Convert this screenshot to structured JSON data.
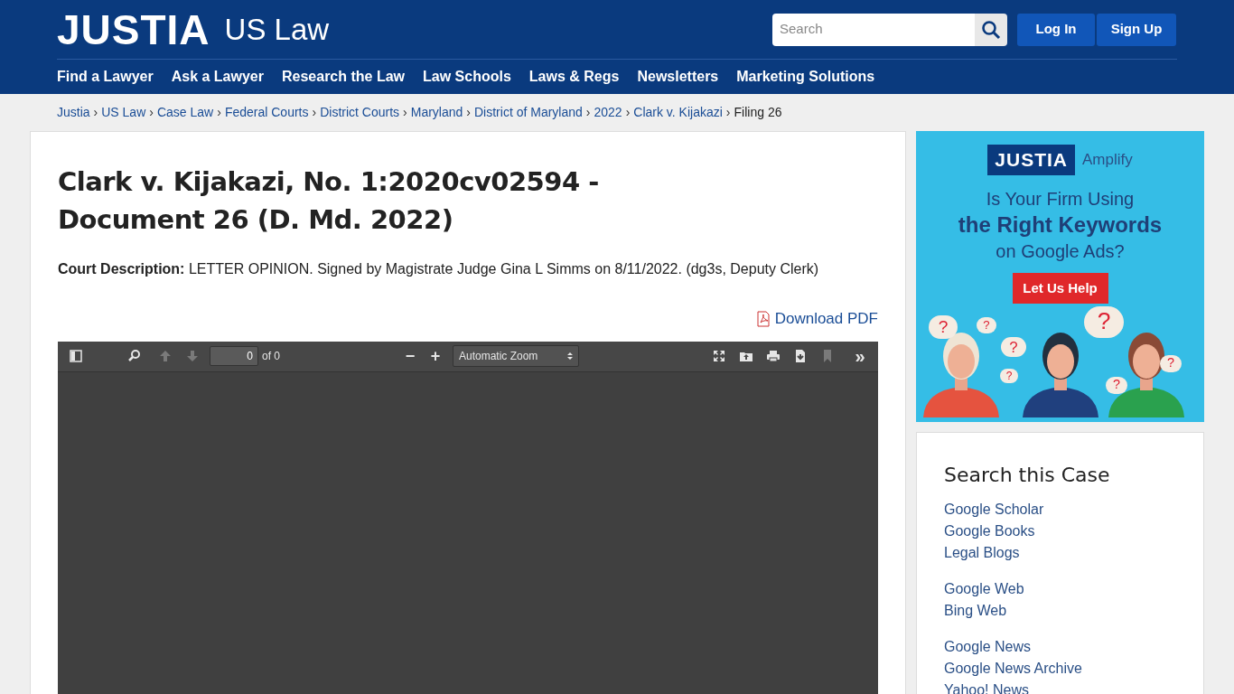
{
  "header": {
    "logo": "JUSTIA",
    "section": "US Law",
    "search": {
      "placeholder": "Search"
    },
    "buttons": [
      "Log In",
      "Sign Up"
    ],
    "nav": [
      "Find a Lawyer",
      "Ask a Lawyer",
      "Research the Law",
      "Law Schools",
      "Laws & Regs",
      "Newsletters",
      "Marketing Solutions"
    ]
  },
  "breadcrumbs": [
    {
      "label": "Justia",
      "link": true
    },
    {
      "label": "US Law",
      "link": true
    },
    {
      "label": "Case Law",
      "link": true
    },
    {
      "label": "Federal Courts",
      "link": true
    },
    {
      "label": "District Courts",
      "link": true
    },
    {
      "label": "Maryland",
      "link": true
    },
    {
      "label": "District of Maryland",
      "link": true
    },
    {
      "label": "2022",
      "link": true
    },
    {
      "label": "Clark v. Kijakazi",
      "link": true
    },
    {
      "label": "Filing 26",
      "link": false
    }
  ],
  "separator": "›",
  "document": {
    "title_lines": [
      "Clark v. Kijakazi, No. 1:2020cv02594 -",
      "Document 26 (D. Md. 2022)"
    ],
    "description": "**Court Description:** LETTER OPINION. Signed by Magistrate Judge Gina L Simms on 8/11/2022. (dg3s, Deputy Clerk)",
    "download": "Download PDF"
  },
  "pdf_viewer": {
    "tools": [
      {
        "kind": "sidebar",
        "disabled": false
      },
      {
        "kind": "find",
        "disabled": false
      },
      {
        "kind": "prev",
        "disabled": true
      },
      {
        "kind": "next",
        "disabled": true
      }
    ],
    "page": "0",
    "page_count": "of 0",
    "zoom_out": "−",
    "zoom_in": "+",
    "zoom": "Automatic Zoom",
    "right_tools": [
      {
        "kind": "fullscreen",
        "disabled": false
      },
      {
        "kind": "open",
        "disabled": false
      },
      {
        "kind": "print",
        "disabled": false
      },
      {
        "kind": "download",
        "disabled": false
      },
      {
        "kind": "bookmark",
        "disabled": true
      }
    ],
    "more": "»"
  },
  "ad": {
    "logo": "JUSTIA",
    "product": "Amplify",
    "line1": "Is Your Firm Using",
    "line2": "the Right Keywords",
    "line3": "on Google Ads?",
    "button": "Let Us Help",
    "bubbles": [
      "?",
      "?",
      "?",
      "?",
      "?",
      "?",
      "?"
    ]
  },
  "sidebar": {
    "title": "Search this Case",
    "groups": [
      [
        "Google Scholar",
        "Google Books",
        "Legal Blogs"
      ],
      [
        "Google Web",
        "Bing Web"
      ],
      [
        "Google News",
        "Google News Archive",
        "Yahoo! News"
      ]
    ]
  }
}
